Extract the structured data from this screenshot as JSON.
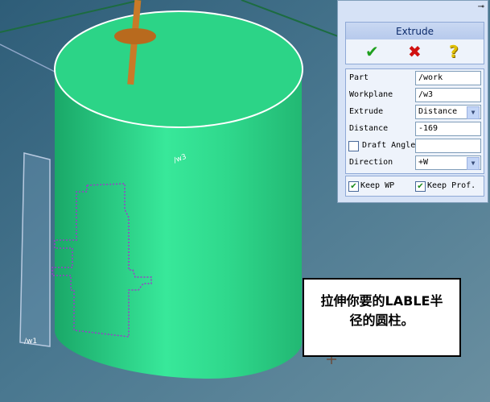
{
  "viewport": {
    "workplane_label_top": "/w3",
    "workplane_label_bottom": "/w1",
    "colors": {
      "background": "#3e6a80",
      "cylinder": "#2cd487",
      "rod": "#c87a28"
    }
  },
  "panel": {
    "pin_icon": "pin-icon",
    "title": "Extrude",
    "ok_icon": "checkmark-icon",
    "cancel_icon": "x-icon",
    "help_icon": "question-icon",
    "fields": {
      "part_label": "Part",
      "part_value": "/work",
      "workplane_label": "Workplane",
      "workplane_value": "/w3",
      "extrude_label": "Extrude",
      "extrude_value": "Distance",
      "distance_label": "Distance",
      "distance_value": "-169",
      "draft_label": "Draft Angle",
      "draft_value": "",
      "direction_label": "Direction",
      "direction_value": "+W"
    },
    "keep_wp_label": "Keep WP",
    "keep_prof_label": "Keep Prof."
  },
  "note": {
    "line1": "拉伸你要的LABLE半",
    "line2": "径的圆柱。"
  }
}
